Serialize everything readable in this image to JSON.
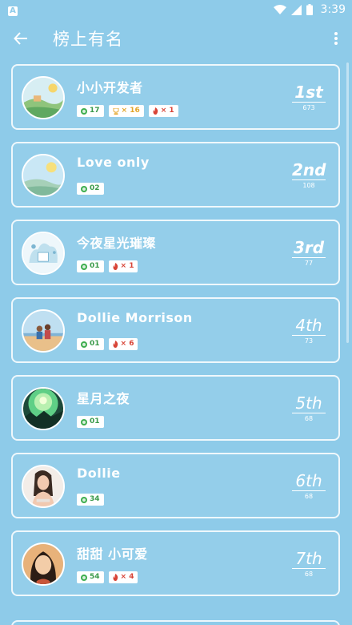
{
  "status": {
    "time": "3:39",
    "notification": "A"
  },
  "header": {
    "title": "榜上有名"
  },
  "entries": [
    {
      "name": "小小开发者",
      "rank": "1st",
      "score": "673",
      "badges": [
        {
          "type": "green",
          "text": "17"
        },
        {
          "type": "gold",
          "text": "× 16"
        },
        {
          "type": "red",
          "text": "× 1"
        }
      ]
    },
    {
      "name": "Love only",
      "rank": "2nd",
      "score": "108",
      "badges": [
        {
          "type": "green",
          "text": "02"
        }
      ]
    },
    {
      "name": "今夜星光璀璨",
      "rank": "3rd",
      "score": "77",
      "badges": [
        {
          "type": "green",
          "text": "01"
        },
        {
          "type": "red",
          "text": "× 1"
        }
      ]
    },
    {
      "name": "Dollie Morrison",
      "rank": "4th",
      "score": "73",
      "badges": [
        {
          "type": "green",
          "text": "01"
        },
        {
          "type": "red",
          "text": "× 6"
        }
      ]
    },
    {
      "name": "星月之夜",
      "rank": "5th",
      "score": "68",
      "badges": [
        {
          "type": "green",
          "text": "01"
        }
      ]
    },
    {
      "name": "Dollie",
      "rank": "6th",
      "score": "68",
      "badges": [
        {
          "type": "green",
          "text": "34"
        }
      ]
    },
    {
      "name": "甜甜 小可爱",
      "rank": "7th",
      "score": "68",
      "badges": [
        {
          "type": "green",
          "text": "54"
        },
        {
          "type": "red",
          "text": "× 4"
        }
      ]
    }
  ],
  "colors": {
    "background": "#8ecbe9",
    "green": "#3fae4f",
    "gold": "#e3a52a",
    "red": "#d84437"
  }
}
